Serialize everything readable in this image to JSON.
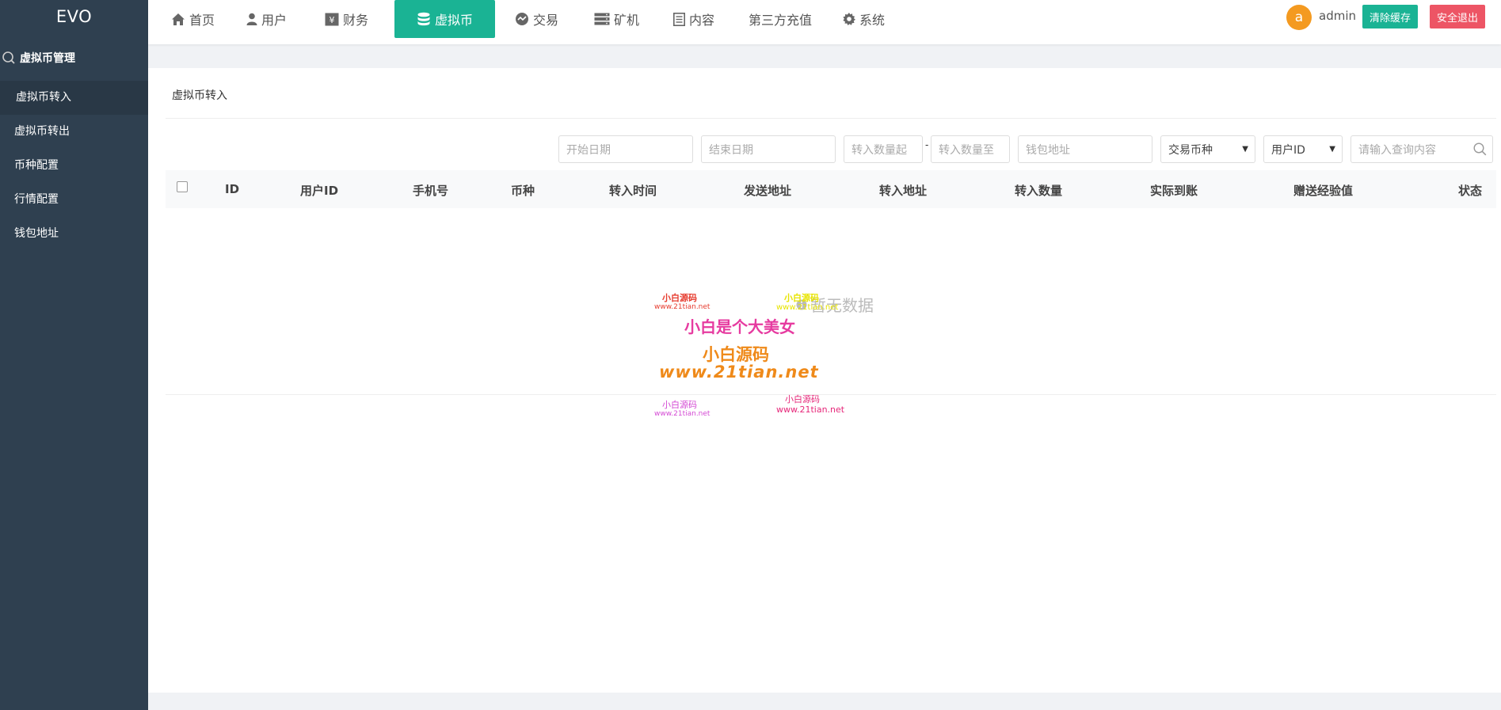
{
  "sidebar": {
    "logo": "EVO",
    "header": "虚拟币管理",
    "items": [
      {
        "label": "虚拟币转入",
        "active": true
      },
      {
        "label": "虚拟币转出"
      },
      {
        "label": "币种配置"
      },
      {
        "label": "行情配置"
      },
      {
        "label": "钱包地址"
      }
    ]
  },
  "nav": {
    "items": [
      {
        "label": "首页",
        "icon": "home-icon"
      },
      {
        "label": "用户",
        "icon": "user-icon"
      },
      {
        "label": "财务",
        "icon": "finance-icon"
      },
      {
        "label": "虚拟币",
        "icon": "database-icon",
        "active": true
      },
      {
        "label": "交易",
        "icon": "exchange-icon"
      },
      {
        "label": "矿机",
        "icon": "server-icon"
      },
      {
        "label": "内容",
        "icon": "document-icon"
      },
      {
        "label": "第三方充值"
      },
      {
        "label": "系统",
        "icon": "gear-icon"
      }
    ],
    "avatar_letter": "a",
    "user": "admin",
    "clear_cache": "清除缓存",
    "logout": "安全退出"
  },
  "panel": {
    "title": "虚拟币转入",
    "filters": {
      "start_date": "开始日期",
      "end_date": "结束日期",
      "amount_from": "转入数量起",
      "dash": "-",
      "amount_to": "转入数量至",
      "wallet": "钱包地址",
      "coin_select": "交易币种",
      "field_select": "用户ID",
      "search": "请输入查询内容"
    },
    "columns": [
      "ID",
      "用户ID",
      "手机号",
      "币种",
      "转入时间",
      "发送地址",
      "转入地址",
      "转入数量",
      "实际到账",
      "赠送经验值",
      "状态"
    ],
    "empty": "暂无数据"
  },
  "watermark": {
    "small1": "小白源码",
    "small1_url": "www.21tian.net",
    "small2": "小白源码",
    "small2_url": "www.21tian.net",
    "big_line": "小白是个大美女",
    "big_name": "小白源码",
    "big_url": "www.21tian.net",
    "small3": "小白源码",
    "small3_url": "www.21tian.net",
    "small4": "小白源码",
    "small4_url": "www.21tian.net"
  },
  "colors": {
    "sidebar": "#2f4050",
    "accent": "#1ab394",
    "danger": "#ed5565",
    "avatar": "#f49a20"
  }
}
